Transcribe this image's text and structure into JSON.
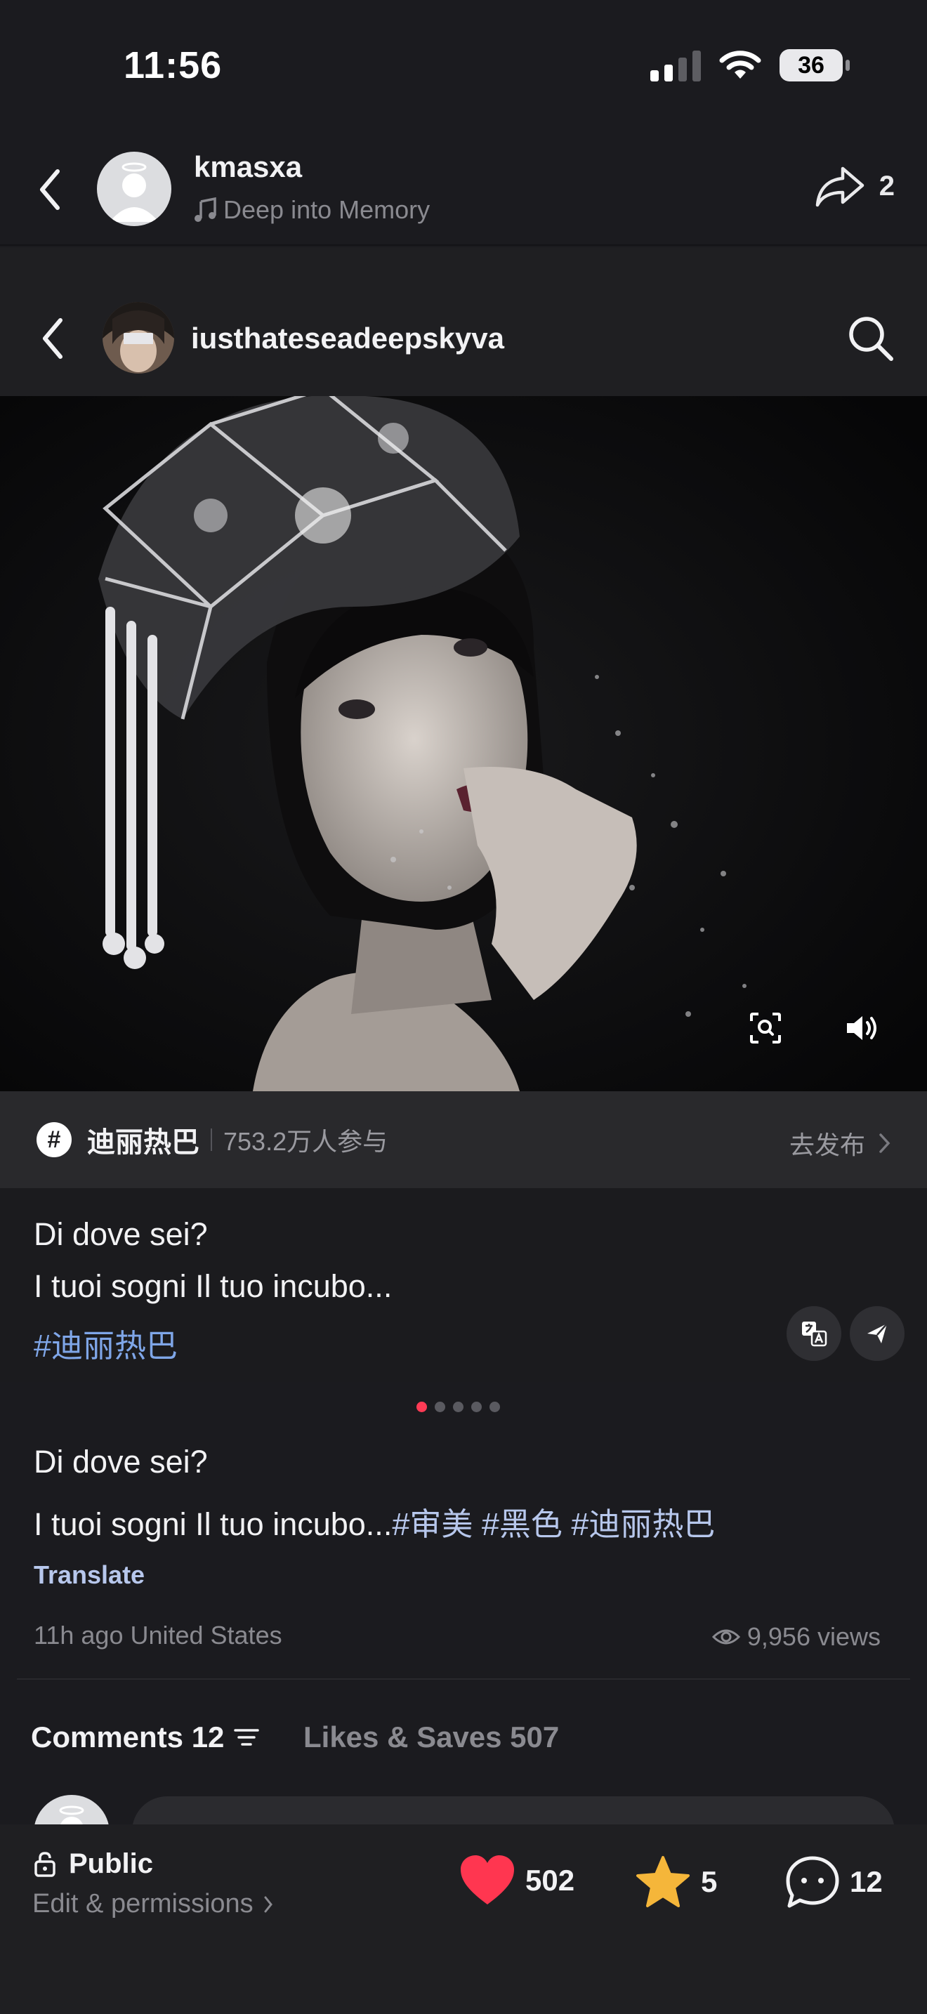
{
  "status_bar": {
    "time": "11:56",
    "battery": "36"
  },
  "top_header": {
    "username": "kmasxa",
    "music": "Deep into Memory",
    "share_count": "2"
  },
  "post_header": {
    "username": "iusthateseadeepskyva"
  },
  "topic": {
    "name": "迪丽热巴",
    "participants": "753.2万人参与",
    "action": "去发布"
  },
  "caption": {
    "line1": "Di dove sei?",
    "line2": "I tuoi sogni Il tuo incubo...",
    "tag": "#迪丽热巴"
  },
  "description": {
    "line1": "Di dove sei?",
    "line2_text": "I tuoi sogni Il tuo incubo...",
    "tags": "#审美 #黑色 #迪丽热巴",
    "translate": "Translate"
  },
  "meta": {
    "time_location": "11h ago United States",
    "views": "9,956 views"
  },
  "tabs": {
    "comments": "Comments 12",
    "likes": "Likes & Saves 507"
  },
  "bottom_bar": {
    "privacy": "Public",
    "edit": "Edit & permissions",
    "likes": "502",
    "stars": "5",
    "comments": "12"
  },
  "colors": {
    "like": "#ff3650",
    "star": "#f5b63a",
    "link": "#7fa6e8",
    "active_dot": "#ff3b55"
  },
  "carousel": {
    "total": 5,
    "active": 1
  }
}
